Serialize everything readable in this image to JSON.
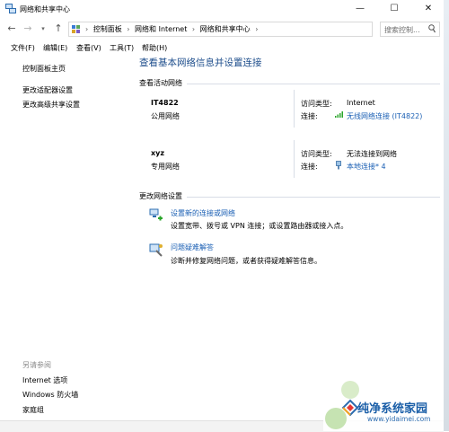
{
  "window": {
    "title": "网络和共享中心",
    "controls": {
      "minimize": "—",
      "maximize": "☐",
      "close": "✕"
    }
  },
  "address": {
    "crumbs": [
      "控制面板",
      "网络和 Internet",
      "网络和共享中心"
    ],
    "separator": "›",
    "search_placeholder": "搜索控制..."
  },
  "menu": [
    "文件(F)",
    "编辑(E)",
    "查看(V)",
    "工具(T)",
    "帮助(H)"
  ],
  "left_nav": {
    "home": "控制面板主页",
    "links": [
      "更改适配器设置",
      "更改高级共享设置"
    ],
    "see_also_title": "另请参阅",
    "see_also": [
      "Internet 选项",
      "Windows 防火墙",
      "家庭组"
    ]
  },
  "main": {
    "title": "查看基本网络信息并设置连接",
    "active_header": "查看活动网络",
    "networks": [
      {
        "name": "IT4822",
        "type": "公用网络",
        "access_label": "访问类型:",
        "access_value": "Internet",
        "conn_label": "连接:",
        "conn_value": "无线网络连接 (IT4822)"
      },
      {
        "name": "xyz",
        "type": "专用网络",
        "access_label": "访问类型:",
        "access_value": "无法连接到网络",
        "conn_label": "连接:",
        "conn_value": "本地连接* 4"
      }
    ],
    "change_header": "更改网络设置",
    "tasks": [
      {
        "link": "设置新的连接或网络",
        "desc": "设置宽带、拨号或 VPN 连接；或设置路由器或接入点。"
      },
      {
        "link": "问题疑难解答",
        "desc": "诊断并修复网络问题，或者获得疑难解答信息。"
      }
    ]
  },
  "watermark": {
    "text": "纯净系统家园",
    "url": "www.yidaimei.com"
  },
  "colors": {
    "link": "#1a5fb4",
    "title": "#1e4e8c",
    "divider": "#d8dde6"
  }
}
